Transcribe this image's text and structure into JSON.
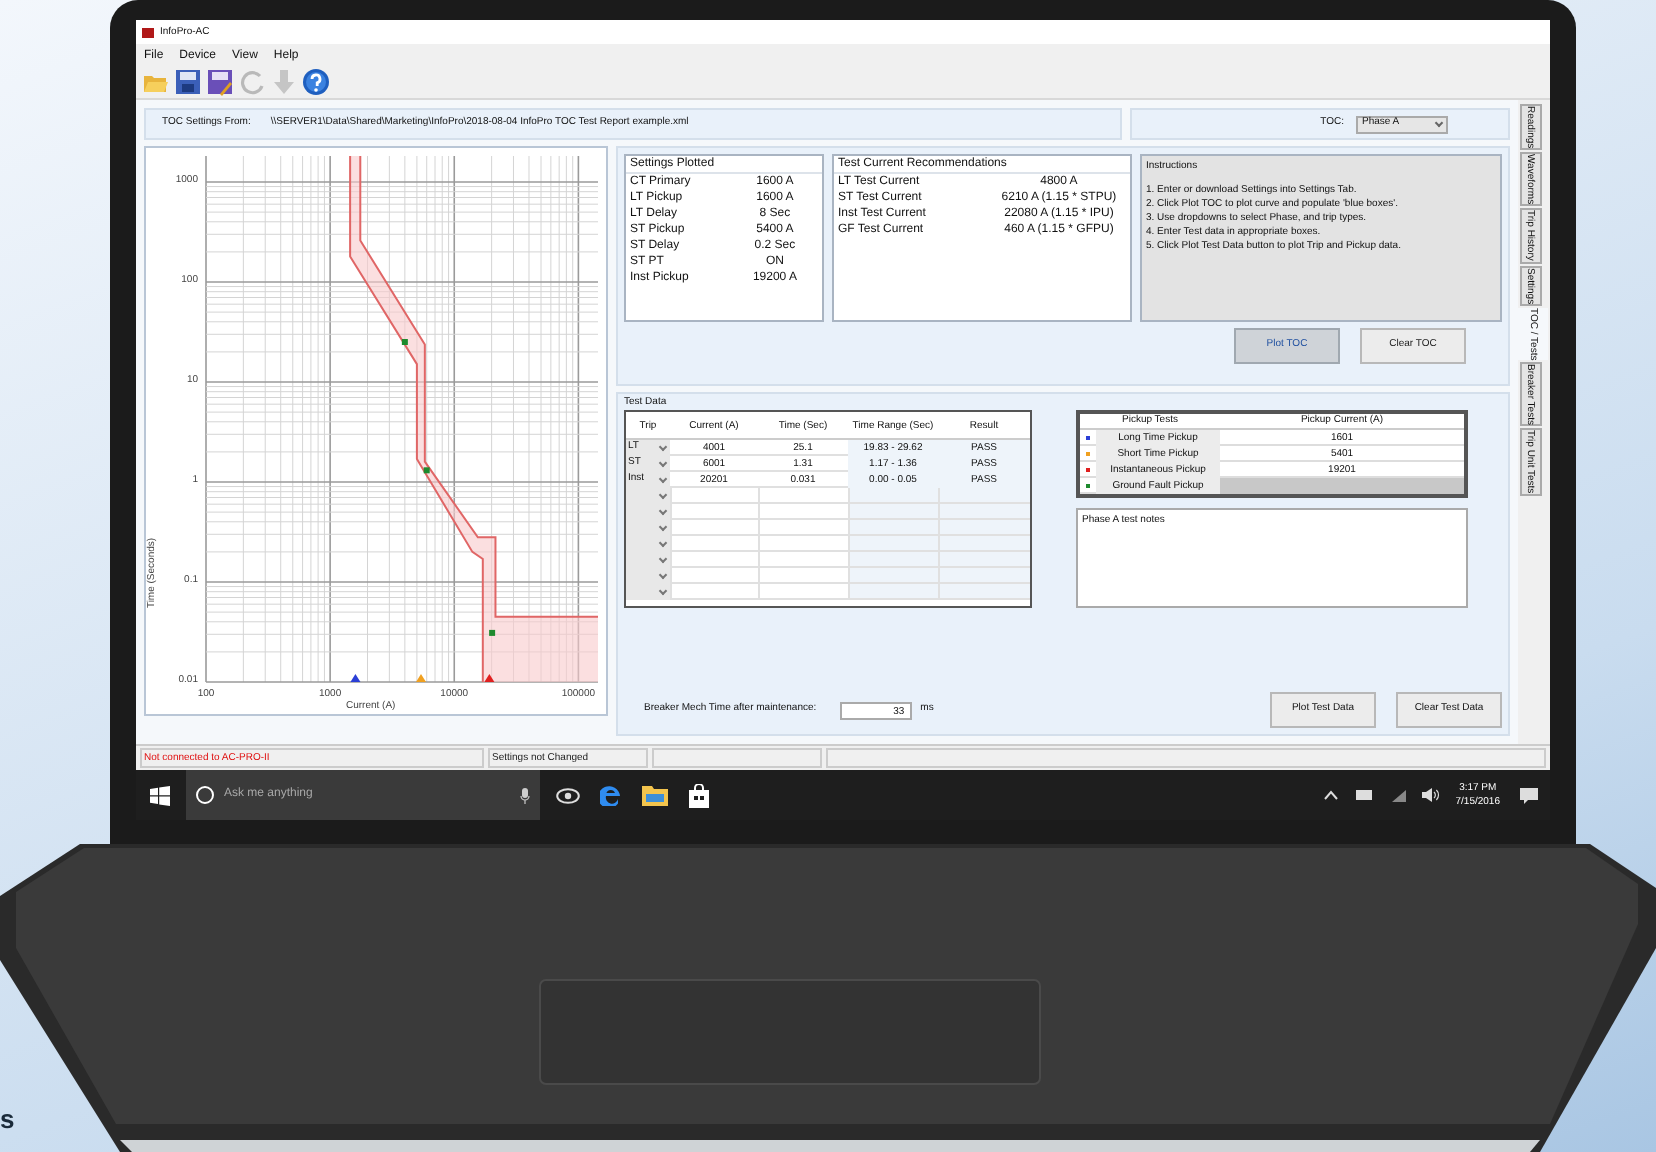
{
  "window": {
    "title": "InfoPro-AC"
  },
  "menu": [
    "File",
    "Device",
    "View",
    "Help"
  ],
  "toolbar": [
    {
      "kind": "open",
      "disabled": false
    },
    {
      "kind": "save",
      "disabled": false
    },
    {
      "kind": "save-as",
      "disabled": false
    },
    {
      "kind": "refresh",
      "disabled": true
    },
    {
      "kind": "download",
      "disabled": true
    },
    {
      "kind": "help",
      "disabled": false
    }
  ],
  "settings_source": {
    "label": "TOC Settings From:",
    "path": "\\\\SERVER1\\Data\\Shared\\Marketing\\InfoPro\\2018-08-04 InfoPro TOC Test Report example.xml"
  },
  "toc_select": {
    "label": "TOC:",
    "value": "Phase A"
  },
  "toc_chart": {
    "xlabel": "Current (A)",
    "ylabel": "Time (Seconds)",
    "x_tick_labels": [
      "100",
      "1000",
      "10000",
      "100000"
    ],
    "y_tick_labels": [
      "1000",
      "100",
      "10",
      "1",
      "0.1",
      "0.01"
    ]
  },
  "settings_plotted": {
    "title": "Settings Plotted",
    "rows": [
      [
        "CT Primary",
        "1600 A"
      ],
      [
        "LT Pickup",
        "1600 A"
      ],
      [
        "LT Delay",
        "8 Sec"
      ],
      [
        "ST Pickup",
        "5400 A"
      ],
      [
        "ST Delay",
        "0.2 Sec"
      ],
      [
        "ST PT",
        "ON"
      ],
      [
        "Inst Pickup",
        "19200 A"
      ]
    ]
  },
  "test_current_recommendations": {
    "title": "Test Current Recommendations",
    "rows": [
      [
        "LT Test Current",
        "4800 A"
      ],
      [
        "ST Test Current",
        "6210 A (1.15 * STPU)"
      ],
      [
        "Inst Test Current",
        "22080 A (1.15 * IPU)"
      ],
      [
        "GF Test Current",
        "460 A (1.15 * GFPU)"
      ]
    ]
  },
  "instructions": {
    "title": "Instructions",
    "lines": [
      "1. Enter or download Settings into Settings Tab.",
      "2. Click Plot TOC to plot curve and populate 'blue boxes'.",
      "3. Use dropdowns to select Phase, and trip types.",
      "4. Enter Test data in appropriate boxes.",
      "5. Click Plot Test Data button to plot Trip and Pickup data."
    ]
  },
  "toc_buttons": [
    {
      "label": "Plot TOC",
      "highlighted": true
    },
    {
      "label": "Clear TOC",
      "highlighted": false
    }
  ],
  "test_data": {
    "title": "Test Data",
    "columns": [
      "Trip",
      "Current (A)",
      "Time (Sec)",
      "Time Range (Sec)",
      "Result"
    ],
    "rows": [
      {
        "kind": "filled",
        "cells": [
          "LT",
          "4001",
          "25.1",
          "19.83 - 29.62",
          "PASS"
        ]
      },
      {
        "kind": "filled",
        "cells": [
          "ST",
          "6001",
          "1.31",
          "1.17 - 1.36",
          "PASS"
        ]
      },
      {
        "kind": "filled",
        "cells": [
          "Inst",
          "20201",
          "0.031",
          "0.00 - 0.05",
          "PASS"
        ]
      },
      {
        "kind": "empty"
      },
      {
        "kind": "empty"
      },
      {
        "kind": "empty"
      },
      {
        "kind": "empty"
      },
      {
        "kind": "empty"
      },
      {
        "kind": "empty"
      },
      {
        "kind": "empty"
      }
    ]
  },
  "pickup_tests": {
    "columns": [
      "Pickup Tests",
      "Pickup Current (A)"
    ],
    "rows": [
      {
        "name": "Long Time Pickup",
        "value": "1601",
        "color": "#2b3fd6"
      },
      {
        "name": "Short Time Pickup",
        "value": "5401",
        "color": "#f0a020"
      },
      {
        "name": "Instantaneous Pickup",
        "value": "19201",
        "color": "#e02020"
      },
      {
        "name": "Ground Fault Pickup",
        "color": "#1e8a2e"
      }
    ]
  },
  "notes": {
    "value": "Phase A test notes"
  },
  "mech_time": {
    "label": "Breaker Mech Time after maintenance:",
    "value": "33",
    "unit": "ms"
  },
  "test_buttons": [
    "Plot Test Data",
    "Clear Test Data"
  ],
  "side_tabs": [
    {
      "label": "Readings",
      "selected": false
    },
    {
      "label": "Waveforms",
      "selected": false
    },
    {
      "label": "Trip History",
      "selected": false
    },
    {
      "label": "Settings",
      "selected": false
    },
    {
      "label": "TOC / Tests",
      "selected": true
    },
    {
      "label": "Breaker Tests",
      "selected": false
    },
    {
      "label": "Trip Unit Tests",
      "selected": false
    }
  ],
  "status_bar": [
    {
      "text": "Not connected to AC-PRO-II",
      "kind": "error"
    },
    {
      "text": "Settings not Changed",
      "kind": "normal"
    }
  ],
  "taskbar": {
    "search_placeholder": "Ask me anything",
    "time": "3:17 PM",
    "date": "7/15/2016"
  },
  "caption_fragment": "s"
}
